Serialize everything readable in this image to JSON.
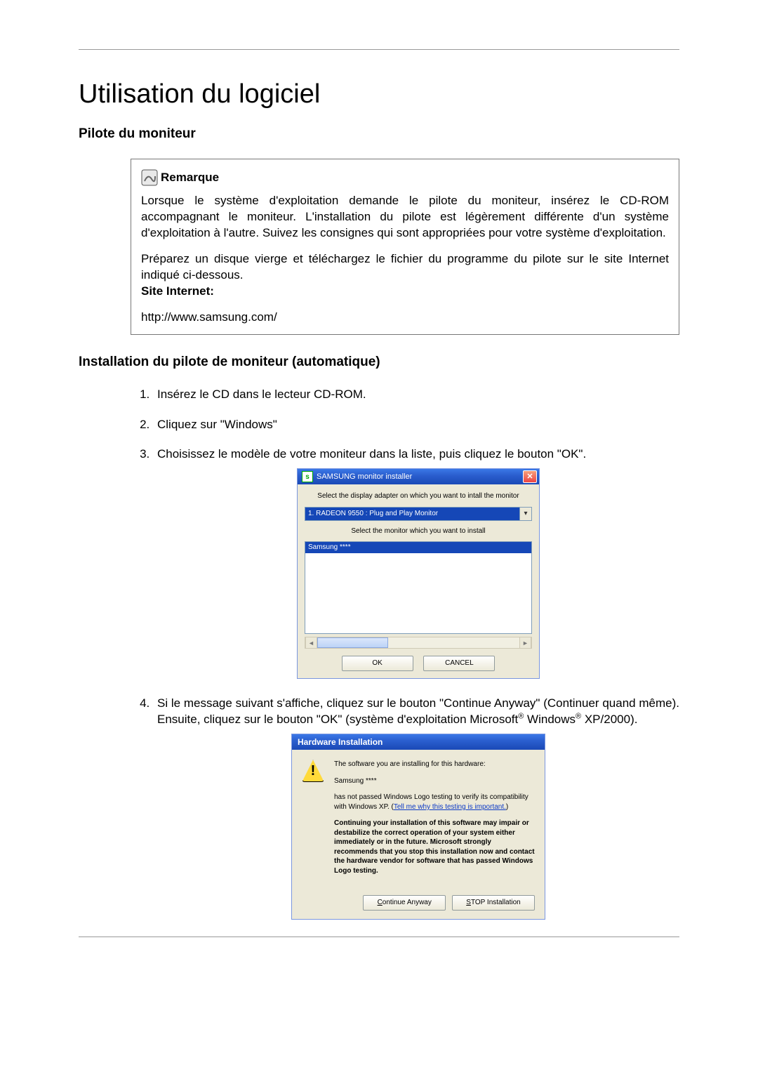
{
  "page": {
    "title": "Utilisation du logiciel",
    "section1_heading": "Pilote du moniteur",
    "remark": {
      "label": "Remarque",
      "p1": "Lorsque le système d'exploitation demande le pilote du moniteur, insérez le CD-ROM accompagnant le moniteur. L'installation du pilote est légèrement différente d'un système d'exploitation à l'autre. Suivez les consignes qui sont appropriées pour votre système d'exploitation.",
      "p2": "Préparez un disque vierge et téléchargez le fichier du programme du pilote sur le site Internet indiqué ci-dessous.",
      "site_label": "Site Internet:",
      "url": "http://www.samsung.com/"
    },
    "section2_heading": "Installation du pilote de moniteur (automatique)",
    "steps": [
      "Insérez le CD dans le lecteur CD-ROM.",
      "Cliquez sur \"Windows\"",
      "Choisissez le modèle de votre moniteur dans la liste, puis cliquez le bouton \"OK\".",
      "Si le message suivant s'affiche, cliquez sur le bouton \"Continue Anyway\" (Continuer quand même). Ensuite, cliquez sur le bouton \"OK\" (système d'exploitation Microsoft® Windows® XP/2000)."
    ]
  },
  "dialog1": {
    "title": "SAMSUNG monitor installer",
    "label_adapter": "Select the display adapter on which you want to intall the monitor",
    "adapter_value": "1. RADEON 9550 : Plug and Play Monitor",
    "label_monitor": "Select the monitor which you want to install",
    "list_selected": "Samsung ****",
    "ok": "OK",
    "cancel": "CANCEL"
  },
  "dialog2": {
    "title": "Hardware Installation",
    "line1": "The software you are installing for this hardware:",
    "device": "Samsung ****",
    "line2a": "has not passed Windows Logo testing to verify its compatibility with Windows XP. (",
    "link": "Tell me why this testing is important.",
    "line2b": ")",
    "bold": "Continuing your installation of this software may impair or destabilize the correct operation of your system either immediately or in the future. Microsoft strongly recommends that you stop this installation now and contact the hardware vendor for software that has passed Windows Logo testing.",
    "continue": "Continue Anyway",
    "stop": "STOP Installation"
  }
}
